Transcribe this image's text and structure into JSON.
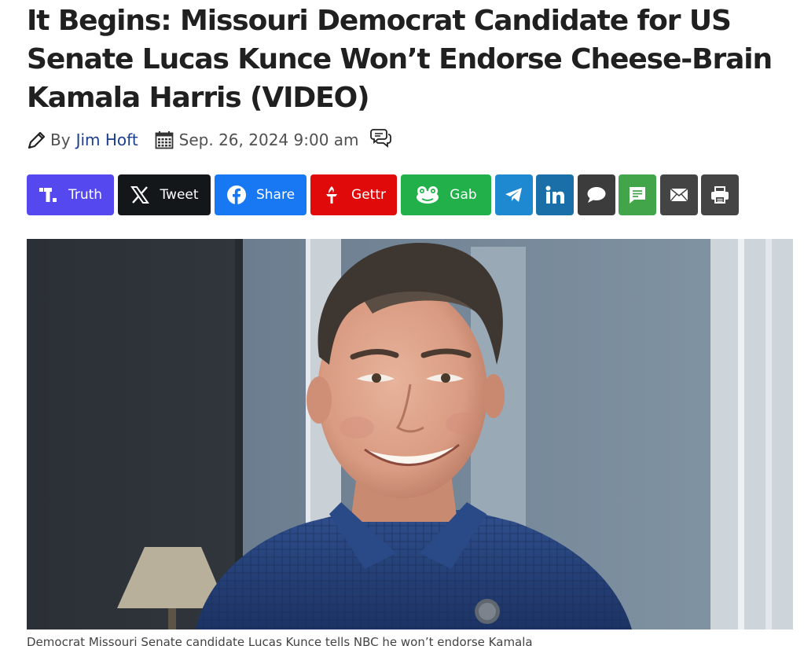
{
  "article": {
    "headline": "It Begins: Missouri Democrat Candidate for US Senate Lucas Kunce Won’t Endorse Cheese-Brain Kamala Harris (VIDEO)",
    "byline_prefix": "By",
    "author": "Jim Hoft",
    "date": "Sep. 26, 2024 9:00 am",
    "caption": "Democrat Missouri Senate candidate Lucas Kunce tells NBC he won’t endorse Kamala"
  },
  "share_buttons": [
    {
      "id": "truth",
      "label": "Truth",
      "icon": "truth-social-icon",
      "color": "#5448ee"
    },
    {
      "id": "tweet",
      "label": "Tweet",
      "icon": "x-icon",
      "color": "#14171a"
    },
    {
      "id": "share",
      "label": "Share",
      "icon": "facebook-icon",
      "color": "#1877f2"
    },
    {
      "id": "gettr",
      "label": "Gettr",
      "icon": "gettr-icon",
      "color": "#e00a0a"
    },
    {
      "id": "gab",
      "label": "Gab",
      "icon": "gab-icon",
      "color": "#21b04a"
    },
    {
      "id": "telegram",
      "label": "",
      "icon": "telegram-icon",
      "color": "#1e88d0"
    },
    {
      "id": "linkedin",
      "label": "",
      "icon": "linkedin-icon",
      "color": "#1a6fa8"
    },
    {
      "id": "comment",
      "label": "",
      "icon": "speech-bubble-icon",
      "color": "#3c3c3c"
    },
    {
      "id": "sms",
      "label": "",
      "icon": "sms-icon",
      "color": "#42a54a"
    },
    {
      "id": "email",
      "label": "",
      "icon": "envelope-icon",
      "color": "#444444"
    },
    {
      "id": "print",
      "label": "",
      "icon": "printer-icon",
      "color": "#444444"
    }
  ]
}
